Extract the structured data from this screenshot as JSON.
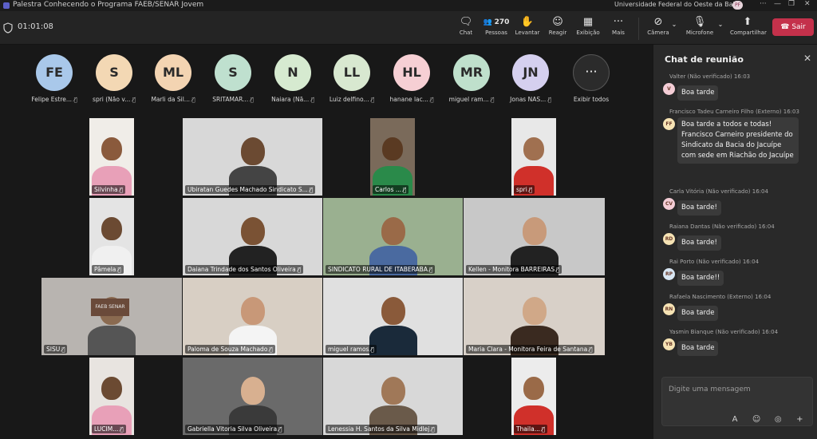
{
  "window": {
    "title": "Palestra Conhecendo o Programa FAEB/SENAR Jovem",
    "org": "Universidade Federal do Oeste da Bahia",
    "org_avatar": "PF"
  },
  "toolbar": {
    "timer": "01:01:08",
    "chat_label": "Chat",
    "people_count": "270",
    "people_label": "Pessoas",
    "raise_label": "Levantar",
    "react_label": "Reagir",
    "view_label": "Exibição",
    "more_label": "Mais",
    "camera_label": "Câmera",
    "mic_label": "Microfone",
    "share_label": "Compartilhar",
    "leave_label": "Sair"
  },
  "avatars": [
    {
      "initials": "FE",
      "name": "Felipe Estre...",
      "color": "#a9c8ea"
    },
    {
      "initials": "S",
      "name": "spri (Não v...",
      "color": "#f3d8b4"
    },
    {
      "initials": "ML",
      "name": "Marli da Sil...",
      "color": "#f3d4b2"
    },
    {
      "initials": "S",
      "name": "SRITAMAR...",
      "color": "#bfe0cf"
    },
    {
      "initials": "N",
      "name": "Naiara (Nã...",
      "color": "#d6ead0"
    },
    {
      "initials": "LL",
      "name": "Luiz delfino...",
      "color": "#d8e8d0"
    },
    {
      "initials": "HL",
      "name": "hanane lac...",
      "color": "#f6cfd4"
    },
    {
      "initials": "MR",
      "name": "miguel ram...",
      "color": "#bfe0cc"
    },
    {
      "initials": "JN",
      "name": "Jonas NAS...",
      "color": "#d5d0ef"
    }
  ],
  "show_all": {
    "icon": "···",
    "label": "Exibir todos"
  },
  "tiles": [
    {
      "name": "Silvinha"
    },
    {
      "name": "Ubiratan Guedes Machado Sindicato S..."
    },
    {
      "name": "Carlos ..."
    },
    {
      "name": "spri"
    },
    {
      "name": "Pâmela"
    },
    {
      "name": "Daiana Trindade dos Santos Oliveira"
    },
    {
      "name": "SINDICATO RURAL DE ITABERABA"
    },
    {
      "name": "Kellen - Monitora BARREIRAS"
    },
    {
      "name": "SISU"
    },
    {
      "name": "Paloma de Souza Machado"
    },
    {
      "name": "miguel ramos"
    },
    {
      "name": "Maria Clara - Monitora Feira de Santana"
    },
    {
      "name": "LUCIM..."
    },
    {
      "name": "Gabriella Vitoria Silva Oliveira"
    },
    {
      "name": "Lenessia H. Santos da Silva Midlej"
    },
    {
      "name": "Thaila..."
    }
  ],
  "sisu_sign": "FAEB SENAR",
  "chat": {
    "title": "Chat de reunião",
    "messages": [
      {
        "author": "Valter (Não verificado)",
        "time": "16:03",
        "initials": "V",
        "color": "#f4cdd6",
        "text": "Boa tarde"
      },
      {
        "author": "Francisco Tadeu Carneiro Filho (Externo)",
        "time": "16:03",
        "initials": "FF",
        "color": "#f6e3b4",
        "text": "Boa tarde a todos e todas! Francisco Carneiro presidente do Sindicato da Bacia do Jacuípe com sede em Riachão do Jacuípe"
      },
      {
        "author": "Carla Vitória (Não verificado)",
        "time": "16:04",
        "initials": "CV",
        "color": "#f4cdd6",
        "text": "Boa tarde!"
      },
      {
        "author": "Raiana Dantas (Não verificado)",
        "time": "16:04",
        "initials": "RD",
        "color": "#f6e3b4",
        "text": "Boa tarde!"
      },
      {
        "author": "Rai Porto (Não verificado)",
        "time": "16:04",
        "initials": "RP",
        "color": "#d8e6f3",
        "text": "Boa tarde!!"
      },
      {
        "author": "Rafaela Nascimento (Externo)",
        "time": "16:04",
        "initials": "RN",
        "color": "#f6e3b4",
        "text": "Boa tarde"
      },
      {
        "author": "Yasmin Bianque (Não verificado)",
        "time": "16:04",
        "initials": "YB",
        "color": "#f6e3b4",
        "text": "Boa tarde"
      }
    ],
    "placeholder": "Digite uma mensagem"
  }
}
